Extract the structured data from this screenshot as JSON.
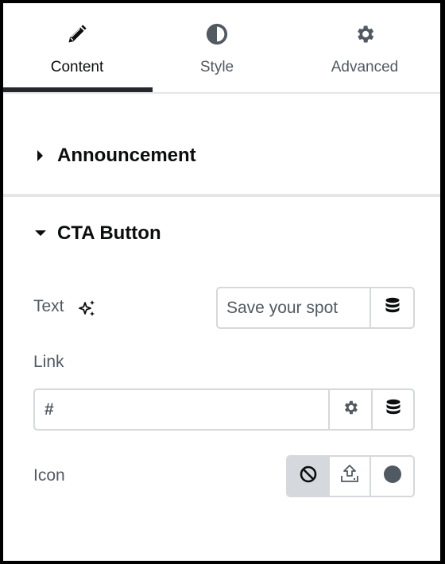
{
  "tabs": [
    {
      "label": "Content",
      "icon": "pencil-icon",
      "active": true
    },
    {
      "label": "Style",
      "icon": "half-circle-contrast-icon",
      "active": false
    },
    {
      "label": "Advanced",
      "icon": "gear-icon",
      "active": false
    }
  ],
  "sections": [
    {
      "title": "Announcement",
      "expanded": false
    },
    {
      "title": "CTA Button",
      "expanded": true
    }
  ],
  "controls": {
    "text": {
      "label": "Text",
      "value": "Save your spot",
      "ai_icon": "sparkle-icon",
      "dynamic_icon": "database-icon"
    },
    "link": {
      "label": "Link",
      "value": "#",
      "options_icon": "gear-icon",
      "dynamic_icon": "database-icon"
    },
    "icon": {
      "label": "Icon",
      "options": [
        {
          "name": "none",
          "icon": "ban-icon",
          "selected": true
        },
        {
          "name": "upload",
          "icon": "upload-icon",
          "selected": false
        },
        {
          "name": "library",
          "icon": "circle-icon",
          "selected": false
        }
      ]
    }
  },
  "colors": {
    "active_text": "#0c0d0e",
    "muted_text": "#515962",
    "border": "#d5d8dc",
    "underline": "#23282d"
  }
}
